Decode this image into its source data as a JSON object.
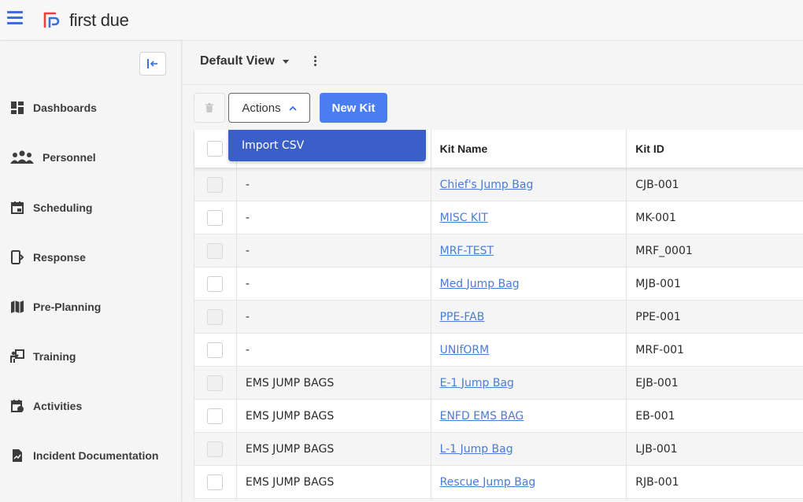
{
  "app": {
    "name": "first due",
    "brand_color": "#e8403a",
    "accent": "#4a7df0"
  },
  "sidebar": {
    "items": [
      {
        "label": "Dashboards",
        "icon": "dashboard-icon"
      },
      {
        "label": "Personnel",
        "icon": "people-icon"
      },
      {
        "label": "Scheduling",
        "icon": "calendar-icon"
      },
      {
        "label": "Response",
        "icon": "response-icon"
      },
      {
        "label": "Pre-Planning",
        "icon": "map-icon"
      },
      {
        "label": "Training",
        "icon": "training-icon"
      },
      {
        "label": "Activities",
        "icon": "activities-icon"
      },
      {
        "label": "Incident Documentation",
        "icon": "document-icon"
      }
    ]
  },
  "view": {
    "title": "Default View"
  },
  "toolbar": {
    "actions_label": "Actions",
    "new_kit_label": "New Kit"
  },
  "actions_menu": {
    "items": [
      "Import CSV"
    ]
  },
  "table": {
    "columns": [
      "",
      "",
      "Kit Name",
      "Kit ID"
    ],
    "rows": [
      {
        "category": "-",
        "kit_name": "Chief's Jump Bag",
        "kit_id": "CJB-001"
      },
      {
        "category": "-",
        "kit_name": "MISC KIT",
        "kit_id": "MK-001"
      },
      {
        "category": "-",
        "kit_name": "MRF-TEST",
        "kit_id": "MRF_0001"
      },
      {
        "category": "-",
        "kit_name": "Med Jump Bag",
        "kit_id": "MJB-001"
      },
      {
        "category": "-",
        "kit_name": "PPE-FAB",
        "kit_id": "PPE-001"
      },
      {
        "category": "-",
        "kit_name": "UNIfORM",
        "kit_id": "MRF-001"
      },
      {
        "category": "EMS JUMP BAGS",
        "kit_name": "E-1 Jump Bag",
        "kit_id": "EJB-001"
      },
      {
        "category": "EMS JUMP BAGS",
        "kit_name": "ENFD EMS BAG",
        "kit_id": "EB-001"
      },
      {
        "category": "EMS JUMP BAGS",
        "kit_name": "L-1 Jump Bag",
        "kit_id": "LJB-001"
      },
      {
        "category": "EMS JUMP BAGS",
        "kit_name": "Rescue Jump Bag",
        "kit_id": "RJB-001"
      }
    ]
  }
}
